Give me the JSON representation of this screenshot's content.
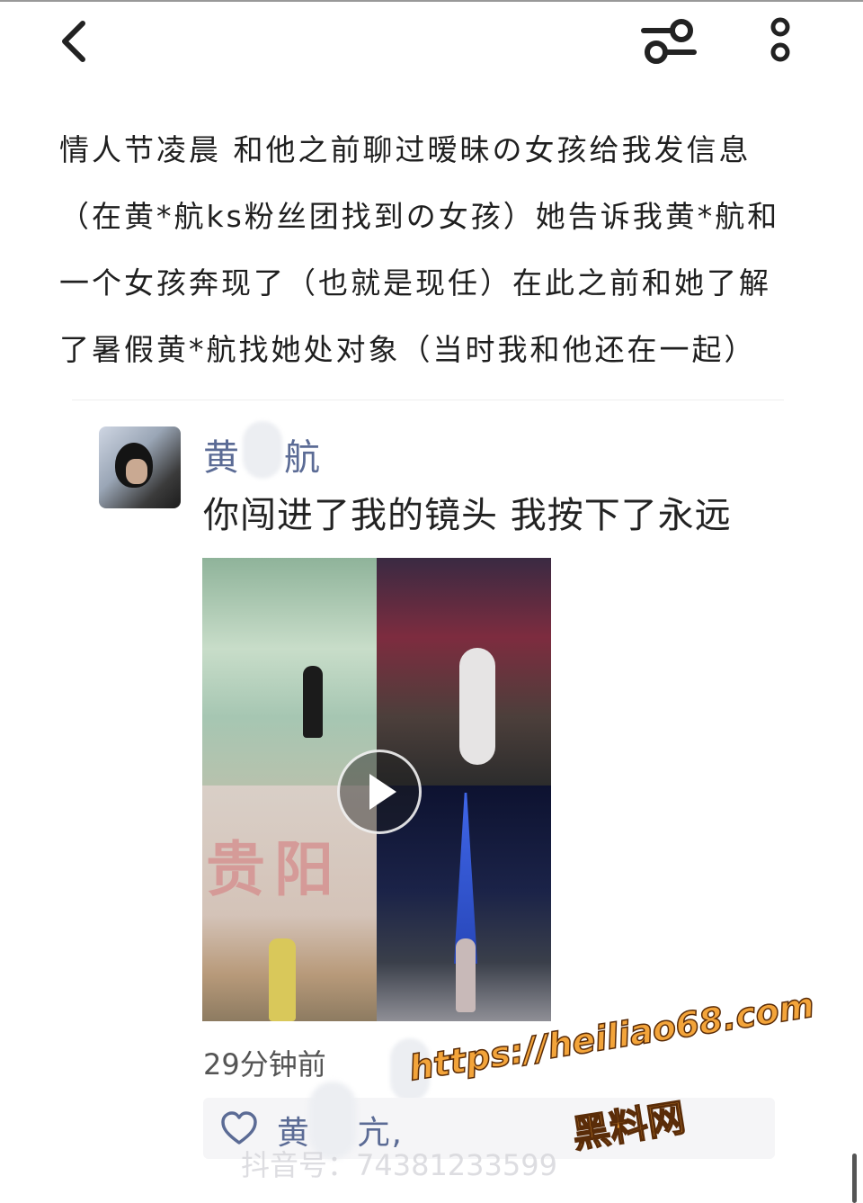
{
  "post": {
    "lines": [
      "情人节凌晨 和他之前聊过暧昧の女孩给我发信息",
      "（在黄*航ks粉丝团找到の女孩）她告诉我黄*航和",
      "一个女孩奔现了（也就是现任）在此之前和她了解",
      "了暑假黄*航找她处对象（当时我和他还在一起）"
    ]
  },
  "moment": {
    "user_name_first": "黄",
    "user_name_last": "航",
    "caption": "你闯进了我的镜头 我按下了永远",
    "media_wall_text": "贵阳",
    "time": "29分钟前",
    "likes_label": "黄　 亢,"
  },
  "watermarks": {
    "url": "https://heiliao68.com",
    "site_name": "黑料网",
    "douyin_id": "抖音号：74381233599"
  },
  "icons": {
    "back": "chevron-left-icon",
    "filter": "sliders-icon",
    "more": "more-vertical-icon",
    "like": "heart-icon",
    "play": "play-icon"
  },
  "colors": {
    "username": "#5b6b95",
    "watermark": "#f3a43a"
  }
}
